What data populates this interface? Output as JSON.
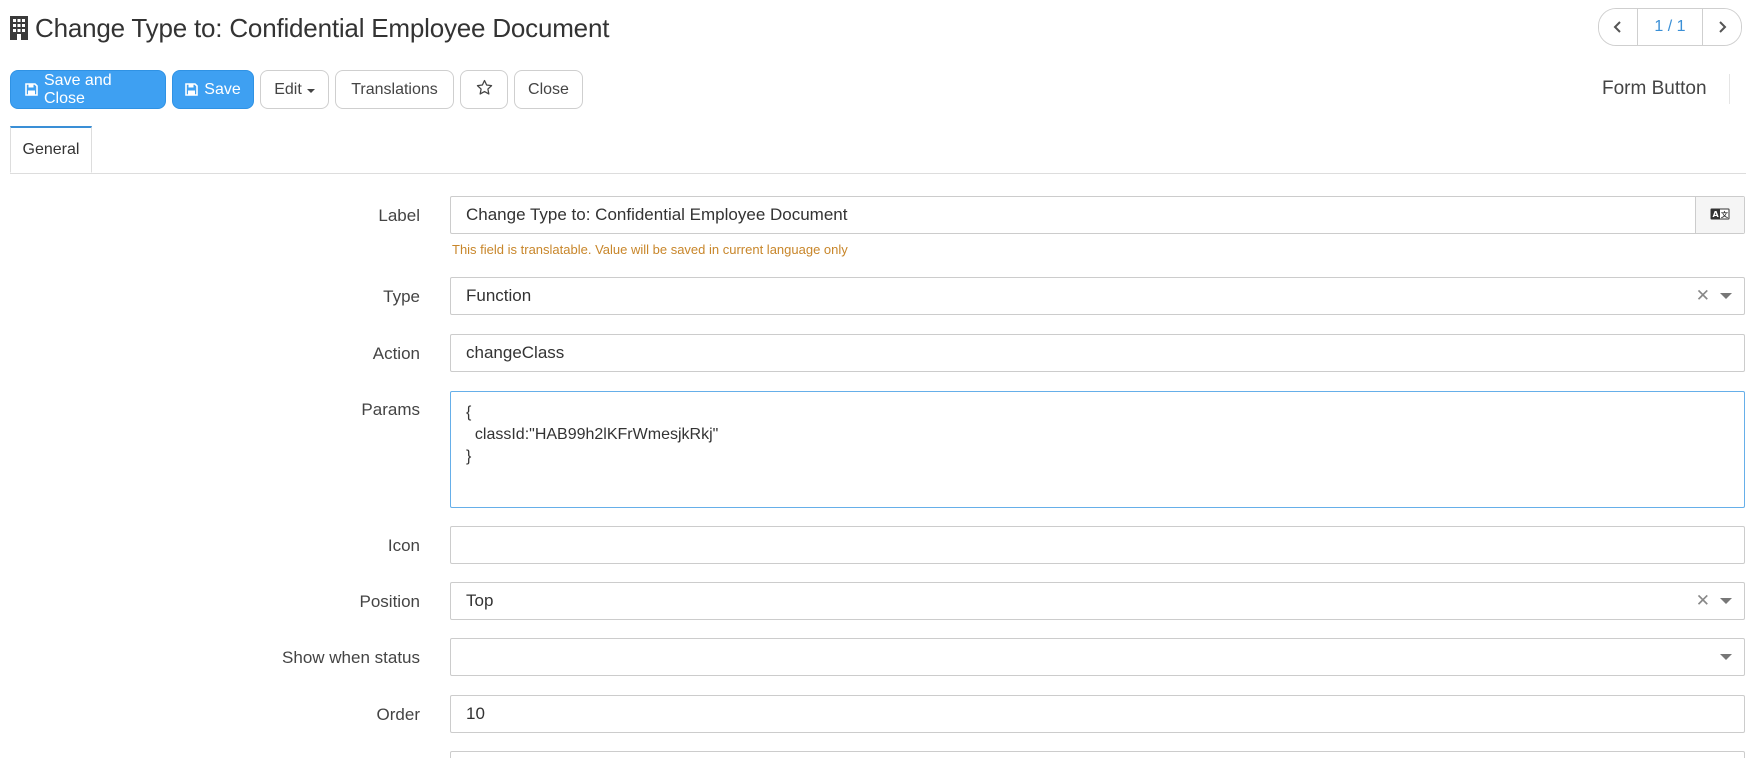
{
  "header": {
    "title": "Change Type to: Confidential Employee Document",
    "title_icon": "building-icon",
    "pager": {
      "prev_icon": "chevron-left-icon",
      "count": "1 / 1",
      "next_icon": "chevron-right-icon"
    }
  },
  "toolbar": {
    "save_close_label": "Save and Close",
    "save_label": "Save",
    "edit_label": "Edit",
    "translations_label": "Translations",
    "favorite_icon": "star-icon",
    "close_label": "Close",
    "record_type": "Form Button"
  },
  "tabs": [
    {
      "label": "General"
    }
  ],
  "form": {
    "label": {
      "caption": "Label",
      "value": "Change Type to: Confidential Employee Document",
      "hint": "This field is translatable. Value will be saved in current language only"
    },
    "type": {
      "caption": "Type",
      "value": "Function"
    },
    "action": {
      "caption": "Action",
      "value": "changeClass"
    },
    "params": {
      "caption": "Params",
      "value": "{\n  classId:\"HAB99h2lKFrWmesjkRkj\"\n}"
    },
    "icon": {
      "caption": "Icon",
      "value": ""
    },
    "position": {
      "caption": "Position",
      "value": "Top"
    },
    "show_when_status": {
      "caption": "Show when status",
      "value": ""
    },
    "order": {
      "caption": "Order",
      "value": "10"
    }
  },
  "colors": {
    "primary": "#3ea0f2",
    "accent_link": "#3a8fd6",
    "hint": "#c8862a",
    "focus_border": "#66afe9"
  }
}
